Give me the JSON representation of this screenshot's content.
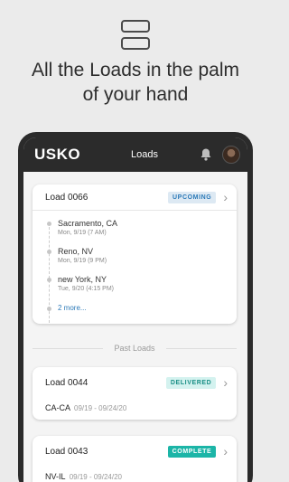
{
  "promo": {
    "icon": "stacked-cards-icon",
    "tagline_line1": "All the Loads in the palm",
    "tagline_line2": "of your hand"
  },
  "appbar": {
    "logo": "USKO",
    "title": "Loads",
    "icons": [
      "bell-icon",
      "avatar"
    ]
  },
  "current_load": {
    "title": "Load 0066",
    "status": "UPCOMING",
    "stops": [
      {
        "city": "Sacramento, CA",
        "date": "Mon, 9/19 (7 AM)"
      },
      {
        "city": "Reno, NV",
        "date": "Mon, 9/19 (9 PM)"
      },
      {
        "city": "new York, NY",
        "date": "Tue, 9/20 (4:15 PM)"
      }
    ],
    "more_label": "2 more..."
  },
  "past_section_label": "Past Loads",
  "past_loads": [
    {
      "title": "Load 0044",
      "status": "DELIVERED",
      "route": "CA-CA",
      "dates": "09/19 - 09/24/20"
    },
    {
      "title": "Load 0043",
      "status": "COMPLETE",
      "route": "NV-IL",
      "dates": "09/19 - 09/24/20"
    }
  ],
  "colors": {
    "appbar": "#2b2b2b",
    "upcoming": "#2c7ab8",
    "delivered": "#1b8f86",
    "complete": "#1cb5a7"
  }
}
